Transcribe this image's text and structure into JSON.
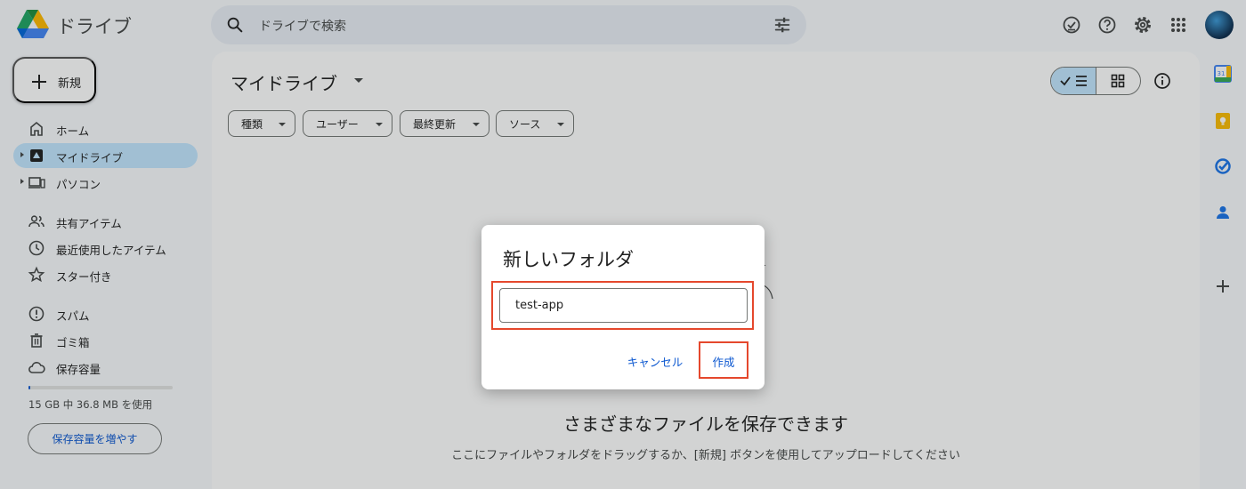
{
  "header": {
    "app_name": "ドライブ",
    "search_placeholder": "ドライブで検索"
  },
  "sidebar": {
    "new_label": "新規",
    "items": [
      {
        "label": "ホーム"
      },
      {
        "label": "マイドライブ"
      },
      {
        "label": "パソコン"
      },
      {
        "label": "共有アイテム"
      },
      {
        "label": "最近使用したアイテム"
      },
      {
        "label": "スター付き"
      },
      {
        "label": "スパム"
      },
      {
        "label": "ゴミ箱"
      },
      {
        "label": "保存容量"
      }
    ],
    "storage": {
      "usage_text": "15 GB 中 36.8 MB を使用",
      "used_fraction": 0.0024,
      "upgrade_label": "保存容量を増やす"
    }
  },
  "main": {
    "title": "マイドライブ",
    "filters": [
      "種類",
      "ユーザー",
      "最終更新",
      "ソース"
    ],
    "empty_title": "さまざまなファイルを保存できます",
    "empty_subtitle": "ここにファイルやフォルダをドラッグするか、[新規] ボタンを使用してアップロードしてください"
  },
  "dialog": {
    "title": "新しいフォルダ",
    "input_value": "test-app",
    "cancel_label": "キャンセル",
    "create_label": "作成"
  },
  "colors": {
    "accent": "#0b57d0",
    "selected_bg": "#c2e7ff",
    "highlight": "#e5482d"
  }
}
